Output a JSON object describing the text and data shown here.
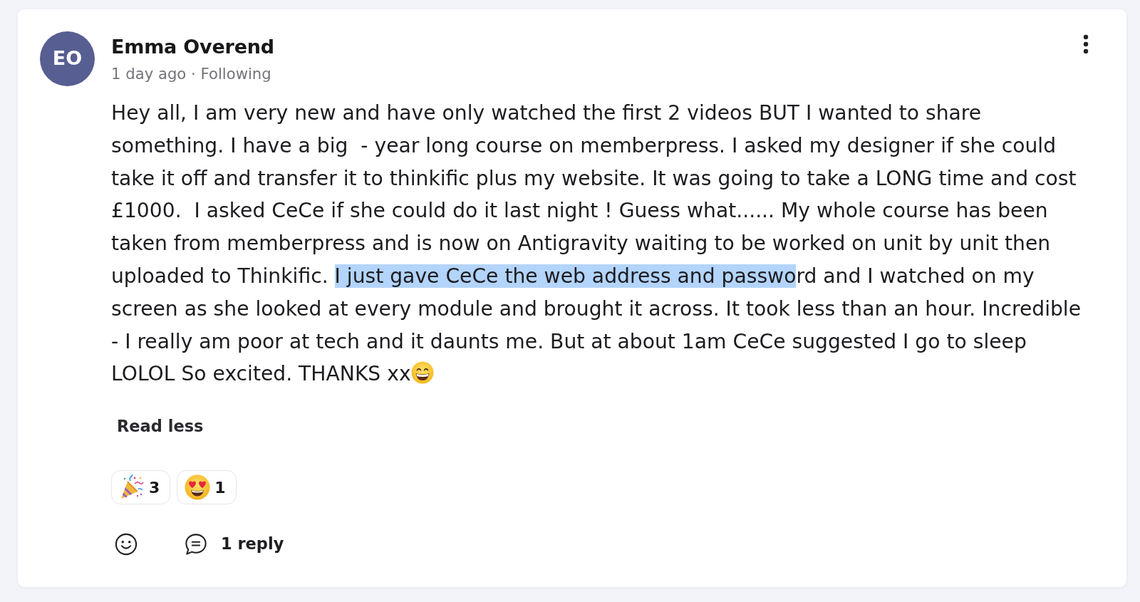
{
  "post": {
    "author": {
      "initials": "EO",
      "name": "Emma Overend"
    },
    "meta": "1 day ago · Following",
    "body": [
      {
        "text": "Hey all, I am very new and have only watched the first 2 videos BUT I wanted to share\nsomething. I have a big  - year long course on memberpress. I asked my designer if she could take it off and transfer it to thinkific plus my website. It was going to take a LONG time and cost £1000.  I asked CeCe if she could do it last night ! Guess what...... My whole course has been taken from memberpress and is now on Antigravity waiting to be worked on unit by unit then uploaded to Thinkific. ",
        "selected": false
      },
      {
        "text": "I just gave CeCe the web address and passwo",
        "selected": true
      },
      {
        "text": "rd and I watched on my screen as she looked at every module and brought it across. It took less than an hour. Incredible - I really am poor at tech and it daunts me. But at about 1am CeCe suggested I go to sleep LOLOL So excited. THANKS xx",
        "selected": false
      }
    ],
    "toggle_label": "Read less",
    "reactions": [
      {
        "kind": "party",
        "count": "3"
      },
      {
        "kind": "heart_eyes",
        "count": "1"
      }
    ],
    "reply_count": "1 reply"
  }
}
